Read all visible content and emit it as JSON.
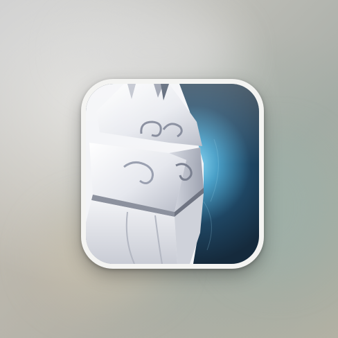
{
  "app_icon": {
    "icon": "armored-knight-icon",
    "colors": {
      "armor": "#e9eaee",
      "armor_shadow": "#b9bdc8",
      "background_dark": "#1d3a52",
      "background_glow": "#7fd3f5",
      "frame": "#f4f4f2"
    }
  }
}
